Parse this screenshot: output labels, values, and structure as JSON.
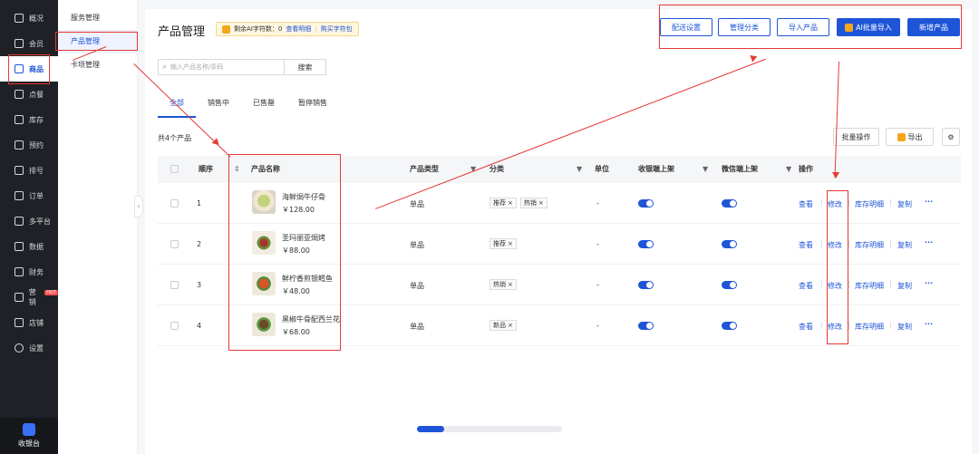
{
  "sidebar": {
    "items": [
      {
        "label": "概况",
        "icon": "grid-icon"
      },
      {
        "label": "会员",
        "icon": "crown-icon"
      },
      {
        "label": "商品",
        "icon": "shop-icon",
        "active": true
      },
      {
        "label": "点餐",
        "icon": "dish-icon"
      },
      {
        "label": "库存",
        "icon": "warehouse-icon"
      },
      {
        "label": "预约",
        "icon": "calendar-check-icon"
      },
      {
        "label": "排号",
        "icon": "queue-icon"
      },
      {
        "label": "订单",
        "icon": "order-icon"
      },
      {
        "label": "多平台",
        "icon": "layers-icon"
      },
      {
        "label": "数据",
        "icon": "chart-icon"
      },
      {
        "label": "财务",
        "icon": "finance-icon"
      },
      {
        "label": "营销",
        "icon": "marketing-icon",
        "badge": "HOT"
      },
      {
        "label": "店铺",
        "icon": "store-icon"
      },
      {
        "label": "设置",
        "icon": "settings-icon"
      }
    ],
    "cashier_label": "收银台"
  },
  "submenu": {
    "items": [
      {
        "label": "服务管理"
      },
      {
        "label": "产品管理",
        "active": true
      },
      {
        "label": "卡项管理"
      }
    ]
  },
  "header": {
    "title": "产品管理",
    "ai_quota_text": "剩余AI字符数：0",
    "ai_view_detail": "查看明细",
    "ai_buy": "购买字符包",
    "buttons": {
      "delivery": "配送设置",
      "category": "管理分类",
      "import": "导入产品",
      "ai_import": "AI批量导入",
      "add": "新增产品"
    }
  },
  "search": {
    "placeholder": "输入产品名称/条码",
    "button": "搜索"
  },
  "tabs": [
    {
      "label": "全部",
      "active": true
    },
    {
      "label": "销售中"
    },
    {
      "label": "已售罄"
    },
    {
      "label": "暂停销售"
    }
  ],
  "count_text": "共4个产品",
  "toolbar": {
    "batch": "批量操作",
    "export": "导出"
  },
  "table": {
    "headers": {
      "order": "顺序",
      "name": "产品名称",
      "type": "产品类型",
      "category": "分类",
      "unit": "单位",
      "pos_shelf": "收银端上架",
      "wechat_shelf": "微信端上架",
      "actions": "操作"
    },
    "rows": [
      {
        "order": "1",
        "name": "海鲜焗牛仔骨",
        "price": "￥128.00",
        "type": "单品",
        "tags": [
          "推荐",
          "热销"
        ],
        "unit": "-",
        "pos": true,
        "wechat": true
      },
      {
        "order": "2",
        "name": "圣玛丽亚焗烤",
        "price": "￥88.00",
        "type": "单品",
        "tags": [
          "推荐"
        ],
        "unit": "-",
        "pos": true,
        "wechat": true
      },
      {
        "order": "3",
        "name": "鲜柠香煎银鳕鱼",
        "price": "￥48.00",
        "type": "单品",
        "tags": [
          "热销"
        ],
        "unit": "-",
        "pos": true,
        "wechat": true
      },
      {
        "order": "4",
        "name": "黑椒牛骨配西兰花",
        "price": "￥68.00",
        "type": "单品",
        "tags": [
          "新品"
        ],
        "unit": "-",
        "pos": true,
        "wechat": true
      }
    ],
    "actions": {
      "view": "查看",
      "edit": "修改",
      "stock": "库存明细",
      "copy": "复制",
      "more": "···"
    }
  },
  "colors": {
    "primary": "#1e54d8",
    "sidebar_bg": "#1f2126",
    "annotation": "#e53935",
    "ai_badge_bg": "#fff7e0"
  }
}
